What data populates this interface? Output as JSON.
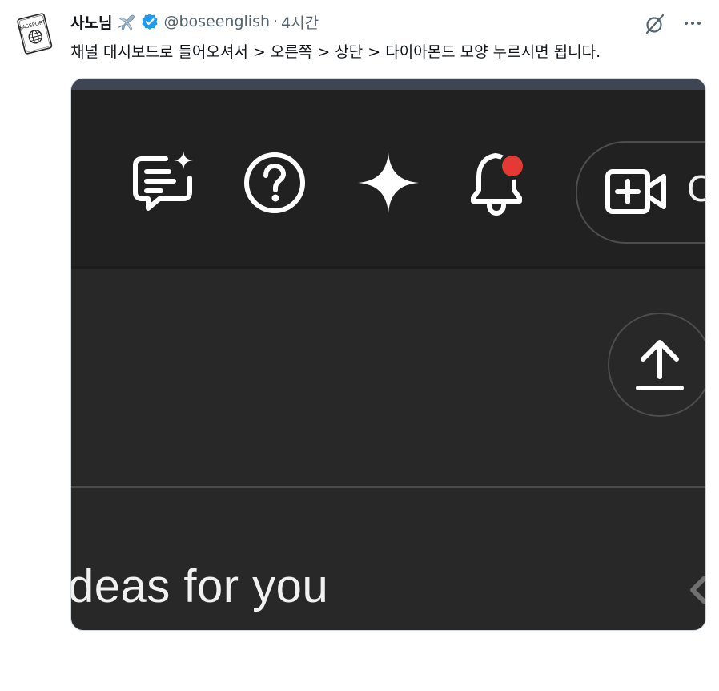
{
  "tweet": {
    "author_name": "사노님",
    "handle": "@boseenglish",
    "separator": "·",
    "time": "4시간",
    "text": "채널 대시보드로 들어오셔서 > 오른쪽 > 상단 > 다이아몬드 모양 누르시면 됩니다.",
    "avatar_badge_text": "PASSPORT",
    "icons": [
      "passport-avatar-icon",
      "airplane-emoji-icon",
      "verified-badge-icon",
      "grok-icon",
      "more-icon"
    ]
  },
  "screenshot": {
    "toolbar_icons": [
      "feedback-sparkle-icon",
      "help-icon",
      "gemini-sparkle-icon",
      "notification-bell-icon",
      "create-video-icon"
    ],
    "create_label": "C",
    "upload_icon": "upload-icon",
    "ideas_text": "deas for you",
    "colors": {
      "background": "#282828",
      "toolbar": "#212121",
      "notification_dot": "#e53935",
      "text": "#f1f1f1"
    }
  }
}
